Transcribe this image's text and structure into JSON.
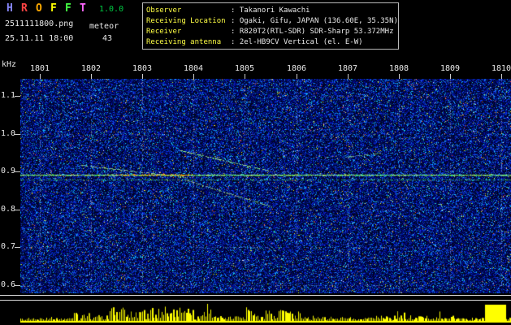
{
  "app": {
    "title_letters": [
      {
        "char": "H",
        "color": "#8888ff"
      },
      {
        "char": "R",
        "color": "#ff4444"
      },
      {
        "char": "O",
        "color": "#ffaa00"
      },
      {
        "char": "F",
        "color": "#ffff00"
      },
      {
        "char": "F",
        "color": "#44ff44"
      },
      {
        "char": "T",
        "color": "#ff66ff"
      }
    ],
    "version": "1.0.0",
    "filename": "2511111800.png",
    "mode": "meteor",
    "datetime": "25.11.11 18:00",
    "echo_count": "43"
  },
  "info_panel": {
    "rows": [
      {
        "label": "Observer",
        "value": ": Takanori Kawachi"
      },
      {
        "label": "Receiving Location",
        "value": ": Ogaki, Gifu, JAPAN (136.60E, 35.35N)"
      },
      {
        "label": "Receiver",
        "value": ": R820T2(RTL-SDR) SDR-Sharp 53.372MHz"
      },
      {
        "label": "Receiving antenna",
        "value": ": 2el-HB9CV Vertical (el. E-W)"
      }
    ]
  },
  "spectrogram": {
    "unit_label": "kHz",
    "time_ticks": [
      "1801",
      "1802",
      "1803",
      "1804",
      "1805",
      "1806",
      "1807",
      "1808",
      "1809",
      "1810"
    ],
    "freq_ticks": [
      "1.1",
      "1.0",
      "0.9",
      "0.8",
      "0.7",
      "0.6"
    ],
    "carrier_line_khz": 0.9,
    "palette": {
      "noise_blue": "#0000c8",
      "carrier_green": "#7dff96",
      "level_bar_yellow": "#ffff00",
      "label_yellow": "#ffff44",
      "text_white": "#e8e8e8"
    }
  }
}
